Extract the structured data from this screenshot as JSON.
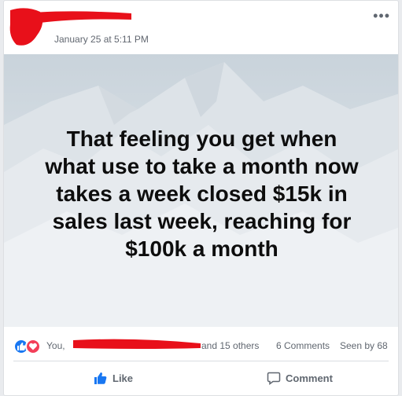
{
  "post": {
    "timestamp": "January 25 at 5:11 PM",
    "more_label": "•••",
    "image_text": "That feeling you get when\nwhat use to take a month now\ntakes a week closed $15k in\nsales last week, reaching for\n$100k a month"
  },
  "stats": {
    "you_label": "You,",
    "others_label": "and 15 others",
    "comments_label": "6 Comments",
    "seen_label": "Seen by 68"
  },
  "actions": {
    "like_label": "Like",
    "comment_label": "Comment"
  },
  "colors": {
    "like_blue": "#1877f2",
    "love_red": "#f33e58",
    "redaction_red": "#e8101a"
  }
}
